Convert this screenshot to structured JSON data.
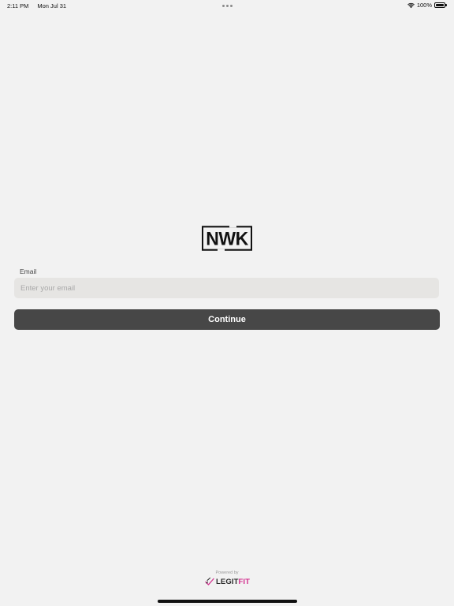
{
  "status_bar": {
    "time": "2:11 PM",
    "date": "Mon Jul 31",
    "battery": "100%",
    "battery_level": 1.0
  },
  "logo": {
    "text": "NWK"
  },
  "form": {
    "email_label": "Email",
    "email_placeholder": "Enter your email",
    "email_value": "",
    "continue_label": "Continue"
  },
  "footer": {
    "powered_by": "Powered by",
    "brand_part1": "LEGIT",
    "brand_part2": "FIT",
    "brand_colors": {
      "primary": "#2a2a2a",
      "accent": "#d3308f"
    }
  },
  "colors": {
    "background": "#f2f2f2",
    "input_background": "#e6e5e3",
    "button_background": "#474747",
    "button_text": "#ffffff"
  }
}
